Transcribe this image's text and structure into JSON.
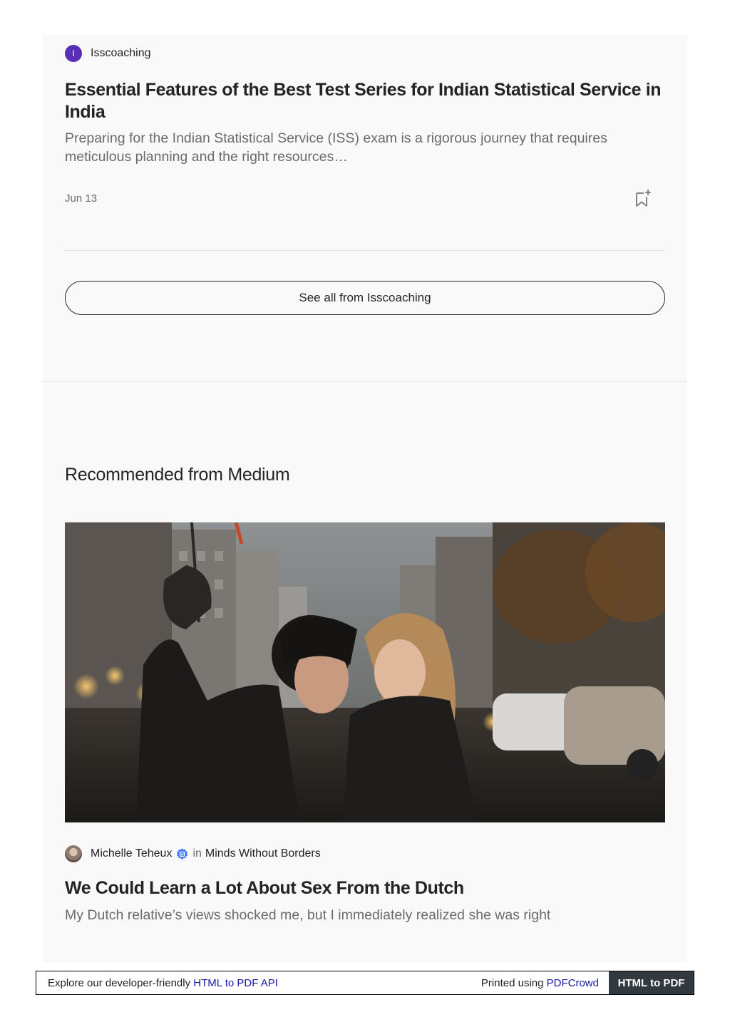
{
  "top_article": {
    "author": {
      "initial": "I",
      "name": "Isscoaching"
    },
    "title": "Essential Features of the Best Test Series for Indian Statistical Service in India",
    "subtitle": "Preparing for the Indian Statistical Service (ISS) exam is a rigorous journey that requires meticulous planning and the right resources…",
    "date": "Jun 13",
    "bookmark_icon": "bookmark-add-icon"
  },
  "see_all_label": "See all from Isscoaching",
  "recommended": {
    "heading": "Recommended from Medium",
    "article": {
      "image_alt": "Couple kissing under an umbrella on a rainy city street",
      "author": "Michelle Teheux",
      "verified_icon": "verified-badge-icon",
      "in_word": "in",
      "publication": "Minds Without Borders",
      "title": "We Could Learn a Lot About Sex From the Dutch",
      "subtitle": "My Dutch relative’s views shocked me, but I immediately realized she was right"
    }
  },
  "footer": {
    "left_text": "Explore our developer-friendly ",
    "left_link": "HTML to PDF API",
    "right_text": "Printed using ",
    "right_link": "PDFCrowd",
    "badge": "HTML to PDF"
  },
  "colors": {
    "panel_bg": "#f9f9f9",
    "text_primary": "#242424",
    "text_secondary": "#6b6b6b",
    "avatar_purple": "#5a2fb8",
    "link_blue": "#1a1aa6",
    "footer_badge_bg": "#333a3f"
  }
}
